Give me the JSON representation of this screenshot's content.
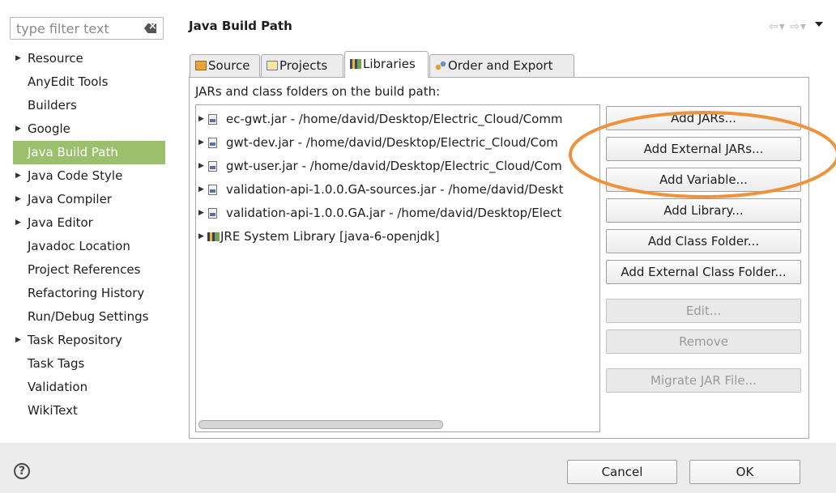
{
  "filter": {
    "placeholder": "type filter text",
    "clear_icon": "clear-filter-icon"
  },
  "nav": [
    {
      "label": "Resource",
      "expandable": true
    },
    {
      "label": "AnyEdit Tools",
      "expandable": false
    },
    {
      "label": "Builders",
      "expandable": false
    },
    {
      "label": "Google",
      "expandable": true
    },
    {
      "label": "Java Build Path",
      "expandable": false,
      "selected": true
    },
    {
      "label": "Java Code Style",
      "expandable": true
    },
    {
      "label": "Java Compiler",
      "expandable": true
    },
    {
      "label": "Java Editor",
      "expandable": true
    },
    {
      "label": "Javadoc Location",
      "expandable": false
    },
    {
      "label": "Project References",
      "expandable": false
    },
    {
      "label": "Refactoring History",
      "expandable": false
    },
    {
      "label": "Run/Debug Settings",
      "expandable": false
    },
    {
      "label": "Task Repository",
      "expandable": true
    },
    {
      "label": "Task Tags",
      "expandable": false
    },
    {
      "label": "Validation",
      "expandable": false
    },
    {
      "label": "WikiText",
      "expandable": false
    }
  ],
  "header": {
    "title": "Java Build Path",
    "history_nav": "⇦▾ ⇨▾"
  },
  "tabs": [
    {
      "label": "Source",
      "icon": "source-folder-icon"
    },
    {
      "label": "Projects",
      "icon": "projects-icon"
    },
    {
      "label": "Libraries",
      "icon": "libraries-icon",
      "active": true
    },
    {
      "label": "Order and Export",
      "icon": "order-export-icon"
    }
  ],
  "libraries": {
    "description": "JARs and class folders on the build path:",
    "entries": [
      {
        "text": "ec-gwt.jar - /home/david/Desktop/Electric_Cloud/Comm",
        "icon": "jar-icon"
      },
      {
        "text": "gwt-dev.jar - /home/david/Desktop/Electric_Cloud/Com",
        "icon": "jar-icon"
      },
      {
        "text": "gwt-user.jar - /home/david/Desktop/Electric_Cloud/Com",
        "icon": "jar-icon"
      },
      {
        "text": "validation-api-1.0.0.GA-sources.jar - /home/david/Deskt",
        "icon": "jar-icon"
      },
      {
        "text": "validation-api-1.0.0.GA.jar - /home/david/Desktop/Elect",
        "icon": "jar-source-icon"
      },
      {
        "text": "JRE System Library [java-6-openjdk]",
        "icon": "library-icon"
      }
    ],
    "buttons": [
      {
        "label": "Add JARs...",
        "enabled": true
      },
      {
        "label": "Add External JARs...",
        "enabled": true
      },
      {
        "label": "Add Variable...",
        "enabled": true
      },
      {
        "label": "Add Library...",
        "enabled": true
      },
      {
        "label": "Add Class Folder...",
        "enabled": true
      },
      {
        "label": "Add External Class Folder...",
        "enabled": true
      },
      {
        "label": "Edit...",
        "enabled": false
      },
      {
        "label": "Remove",
        "enabled": false
      },
      {
        "label": "Migrate JAR File...",
        "enabled": false
      }
    ]
  },
  "footer": {
    "cancel_label": "Cancel",
    "ok_label": "OK",
    "help_icon": "help-icon"
  },
  "colors": {
    "selection": "#9bc06b",
    "annotation": "#f0913c"
  }
}
